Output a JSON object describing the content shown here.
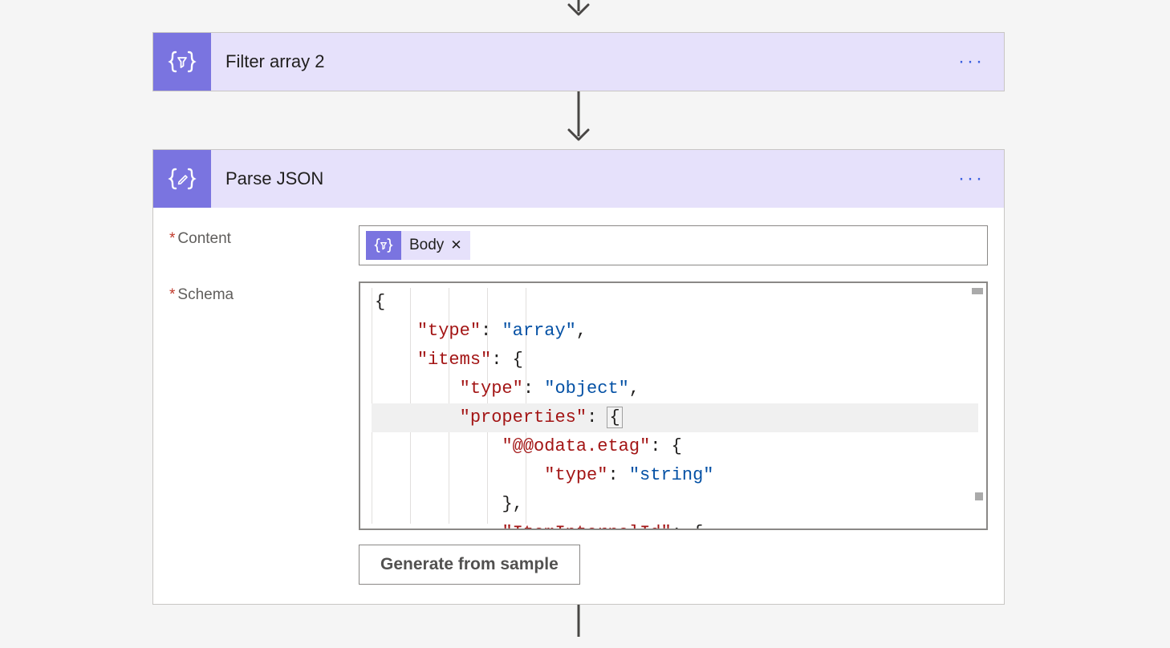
{
  "flow": {
    "steps": [
      {
        "id": "filter-array-2",
        "title": "Filter array 2",
        "icon": "braces-filter"
      },
      {
        "id": "parse-json",
        "title": "Parse JSON",
        "icon": "braces-edit"
      }
    ]
  },
  "parseJson": {
    "fields": {
      "content": {
        "label": "Content",
        "required": true,
        "token": {
          "label": "Body",
          "icon": "braces-filter"
        }
      },
      "schema": {
        "label": "Schema",
        "required": true,
        "lines": [
          {
            "indent": 0,
            "segments": [
              {
                "t": "{",
                "c": "p"
              }
            ]
          },
          {
            "indent": 1,
            "segments": [
              {
                "t": "\"type\"",
                "c": "k"
              },
              {
                "t": ": ",
                "c": "p"
              },
              {
                "t": "\"array\"",
                "c": "s"
              },
              {
                "t": ",",
                "c": "p"
              }
            ]
          },
          {
            "indent": 1,
            "segments": [
              {
                "t": "\"items\"",
                "c": "k"
              },
              {
                "t": ": {",
                "c": "p"
              }
            ]
          },
          {
            "indent": 2,
            "segments": [
              {
                "t": "\"type\"",
                "c": "k"
              },
              {
                "t": ": ",
                "c": "p"
              },
              {
                "t": "\"object\"",
                "c": "s"
              },
              {
                "t": ",",
                "c": "p"
              }
            ]
          },
          {
            "indent": 2,
            "highlight": true,
            "segments": [
              {
                "t": "\"properties\"",
                "c": "k"
              },
              {
                "t": ": ",
                "c": "p"
              },
              {
                "t": "{",
                "c": "p",
                "cursor": true
              }
            ]
          },
          {
            "indent": 3,
            "segments": [
              {
                "t": "\"@@odata.etag\"",
                "c": "k"
              },
              {
                "t": ": {",
                "c": "p"
              }
            ]
          },
          {
            "indent": 4,
            "segments": [
              {
                "t": "\"type\"",
                "c": "k"
              },
              {
                "t": ": ",
                "c": "p"
              },
              {
                "t": "\"string\"",
                "c": "s"
              }
            ]
          },
          {
            "indent": 3,
            "segments": [
              {
                "t": "},",
                "c": "p"
              }
            ]
          },
          {
            "indent": 3,
            "segments": [
              {
                "t": "\"ItemInternalId\"",
                "c": "k"
              },
              {
                "t": ": {",
                "c": "p"
              }
            ]
          }
        ]
      }
    },
    "generateButton": "Generate from sample"
  }
}
